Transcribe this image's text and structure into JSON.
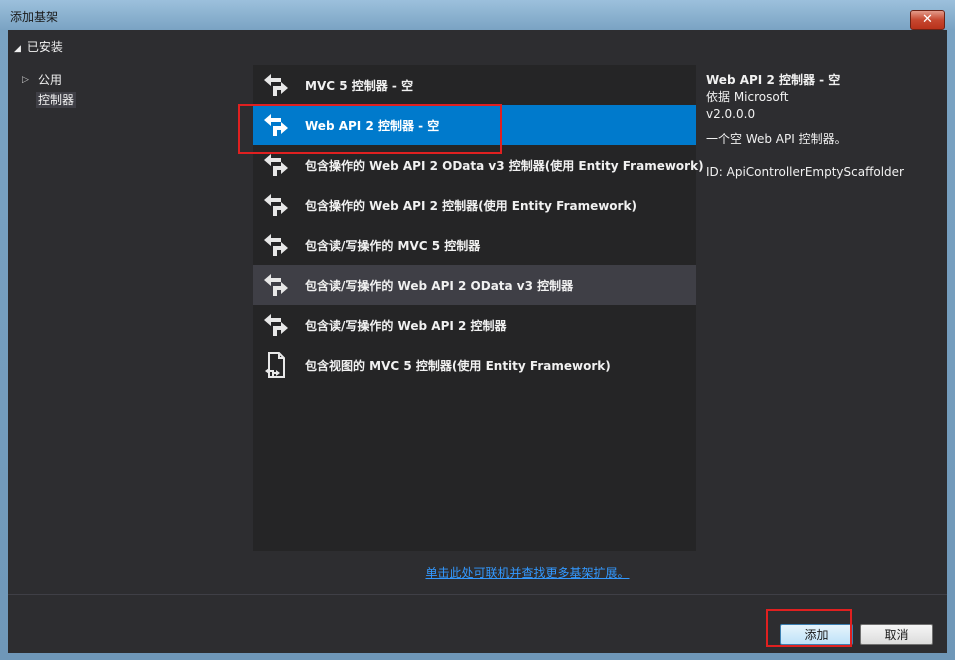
{
  "window": {
    "title": "添加基架",
    "close_label": "✕"
  },
  "sidebar": {
    "header": "已安装",
    "items": [
      {
        "label": "公用",
        "arrow": "▷"
      },
      {
        "label": "控制器"
      }
    ]
  },
  "list": {
    "items": [
      {
        "label": "MVC 5 控制器 - 空"
      },
      {
        "label": "Web API 2 控制器 - 空"
      },
      {
        "label": "包含操作的 Web API 2 OData v3 控制器(使用 Entity Framework)"
      },
      {
        "label": "包含操作的 Web API 2 控制器(使用 Entity Framework)"
      },
      {
        "label": "包含读/写操作的 MVC 5 控制器"
      },
      {
        "label": "包含读/写操作的 Web API 2 OData v3 控制器"
      },
      {
        "label": "包含读/写操作的 Web API 2 控制器"
      },
      {
        "label": "包含视图的 MVC 5 控制器(使用 Entity Framework)"
      }
    ]
  },
  "details": {
    "title": "Web API 2 控制器 - 空",
    "author": "依据 Microsoft",
    "version": "v2.0.0.0",
    "description": "一个空 Web API 控制器。",
    "id": "ID: ApiControllerEmptyScaffolder"
  },
  "online_link": "单击此处可联机并查找更多基架扩展。",
  "buttons": {
    "add": "添加",
    "cancel": "取消"
  },
  "colors": {
    "accent": "#007acc",
    "highlight_border": "#e02020",
    "link": "#3399ff"
  }
}
